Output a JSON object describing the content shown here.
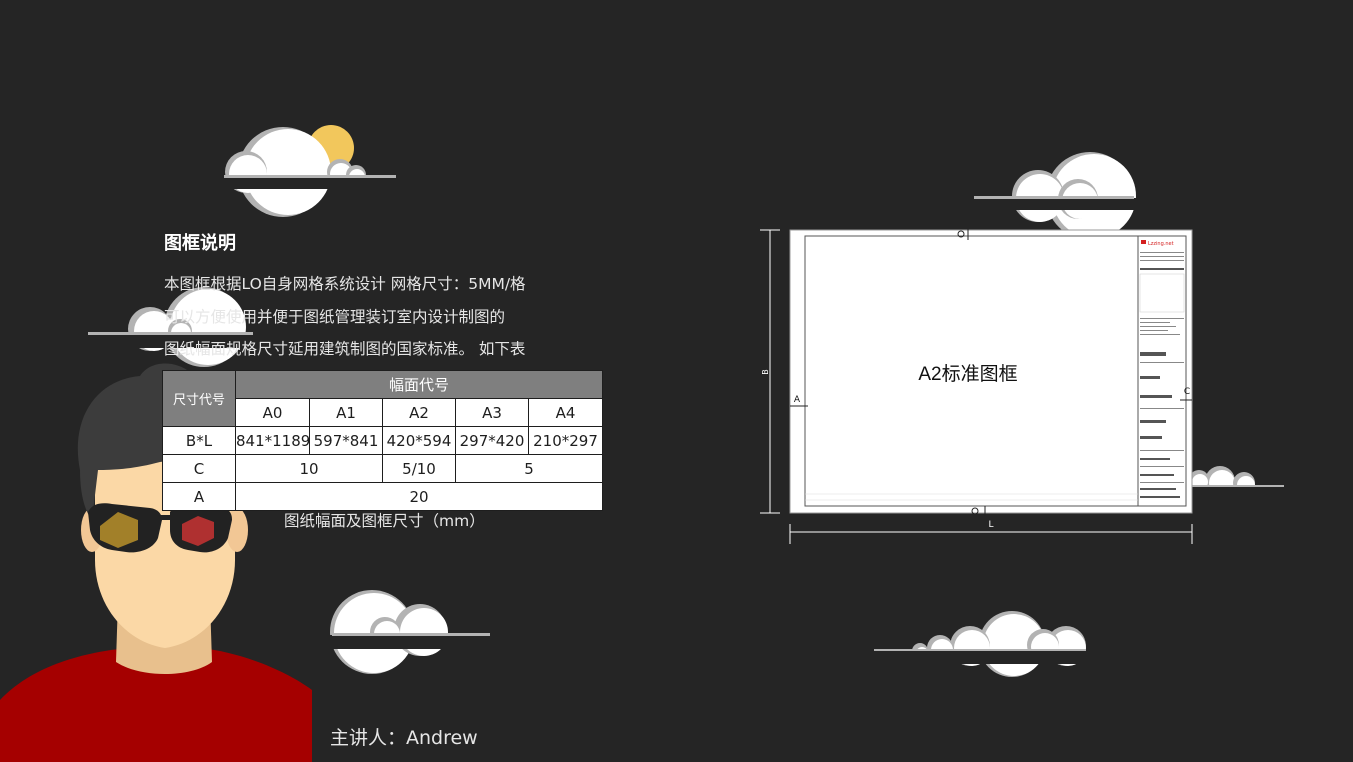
{
  "section": {
    "title": "图框说明",
    "paragraph_lines": [
      "本图框根据LO自身网格系统设计 网格尺寸：5MM/格",
      "可以方便使用并便于图纸管理装订室内设计制图的",
      "图纸幅面规格尺寸延用建筑制图的国家标准。 如下表"
    ]
  },
  "table": {
    "header_label": "尺寸代号",
    "group_header": "幅面代号",
    "columns": [
      "A0",
      "A1",
      "A2",
      "A3",
      "A4"
    ],
    "rows": [
      {
        "label": "B*L",
        "cells": [
          "841*1189",
          "597*841",
          "420*594",
          "297*420",
          "210*297"
        ]
      },
      {
        "label": "C",
        "cells": [
          "10",
          "5/10",
          "5"
        ]
      },
      {
        "label": "A",
        "cells": [
          "20"
        ]
      }
    ],
    "caption": "图纸幅面及图框尺寸（mm）"
  },
  "drawing": {
    "title": "A2标准图框",
    "dim_b": "B",
    "dim_l": "L",
    "dim_a": "A",
    "dim_c": "C",
    "logo_text": "Lzzing.net"
  },
  "speaker": "主讲人：Andrew",
  "colors": {
    "background": "#252525",
    "cloud_fill": "#ffffff",
    "cloud_outline": "#b3b3b3",
    "sun": "#f2c75c",
    "shirt": "#a50000",
    "skin": "#fbd8a6",
    "hair": "#3c3c3c",
    "table_header": "#7f7f7f",
    "logo_red": "#d42020"
  }
}
